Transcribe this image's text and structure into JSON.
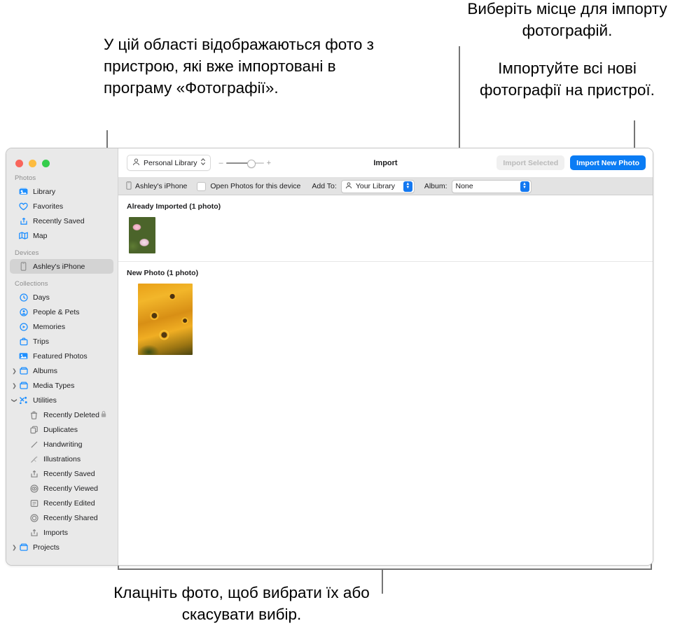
{
  "callouts": {
    "left": "У цій області відображаються фото з пристрою, які вже імпортовані в програму «Фотографії».",
    "top_right_1": "Виберіть місце для імпорту фотографій.",
    "top_right_2": "Імпортуйте всі нові фотографії на пристрої.",
    "bottom": "Клацніть фото, щоб вибрати їх або скасувати вибір."
  },
  "window": {
    "traffic_lights": [
      "close",
      "minimize",
      "zoom"
    ]
  },
  "sidebar": {
    "groups": [
      {
        "title": "Photos",
        "items": [
          {
            "label": "Library",
            "icon": "library-icon"
          },
          {
            "label": "Favorites",
            "icon": "heart-icon"
          },
          {
            "label": "Recently Saved",
            "icon": "recently-saved-icon"
          },
          {
            "label": "Map",
            "icon": "map-icon"
          }
        ]
      },
      {
        "title": "Devices",
        "items": [
          {
            "label": "Ashley's iPhone",
            "icon": "iphone-icon",
            "selected": true
          }
        ]
      },
      {
        "title": "Collections",
        "items": [
          {
            "label": "Days",
            "icon": "clock-icon"
          },
          {
            "label": "People & Pets",
            "icon": "person-icon"
          },
          {
            "label": "Memories",
            "icon": "memories-icon"
          },
          {
            "label": "Trips",
            "icon": "trips-icon"
          },
          {
            "label": "Featured Photos",
            "icon": "featured-photos-icon"
          },
          {
            "label": "Albums",
            "icon": "folder-icon",
            "disclosure": "collapsed"
          },
          {
            "label": "Media Types",
            "icon": "folder-icon",
            "disclosure": "collapsed"
          },
          {
            "label": "Utilities",
            "icon": "utilities-icon",
            "disclosure": "expanded"
          },
          {
            "label": "Recently Deleted",
            "icon": "trash-icon",
            "indent": true,
            "lock": true
          },
          {
            "label": "Duplicates",
            "icon": "duplicates-icon",
            "indent": true
          },
          {
            "label": "Handwriting",
            "icon": "handwriting-icon",
            "indent": true
          },
          {
            "label": "Illustrations",
            "icon": "illustrations-icon",
            "indent": true
          },
          {
            "label": "Recently Saved",
            "icon": "recently-saved-icon",
            "indent": true
          },
          {
            "label": "Recently Viewed",
            "icon": "recently-viewed-icon",
            "indent": true
          },
          {
            "label": "Recently Edited",
            "icon": "recently-edited-icon",
            "indent": true
          },
          {
            "label": "Recently Shared",
            "icon": "recently-shared-icon",
            "indent": true
          },
          {
            "label": "Imports",
            "icon": "imports-icon",
            "indent": true
          },
          {
            "label": "Projects",
            "icon": "folder-icon",
            "disclosure": "collapsed"
          }
        ]
      }
    ]
  },
  "toolbar": {
    "library_popup": "Personal Library",
    "zoom_minus": "–",
    "zoom_plus": "+",
    "title": "Import",
    "import_selected": "Import Selected",
    "import_new_photo": "Import New Photo"
  },
  "optionbar": {
    "device": "Ashley's iPhone",
    "open_photos_label": "Open Photos for this device",
    "open_photos_checked": false,
    "add_to_label": "Add To:",
    "add_to_value": "Your Library",
    "album_label": "Album:",
    "album_value": "None"
  },
  "content": {
    "sections": [
      {
        "heading": "Already Imported (1 photo)",
        "photos": [
          {
            "name": "pink-flowers-photo",
            "size": "small"
          }
        ]
      },
      {
        "heading": "New Photo (1 photo)",
        "photos": [
          {
            "name": "orange-sunflowers-photo",
            "size": "big"
          }
        ]
      }
    ]
  },
  "colors": {
    "accent": "#0a7cf4",
    "sidebar_bg": "#e9e9e9",
    "optionbar_bg": "#e3e3e3",
    "leader_line": "#757575"
  }
}
